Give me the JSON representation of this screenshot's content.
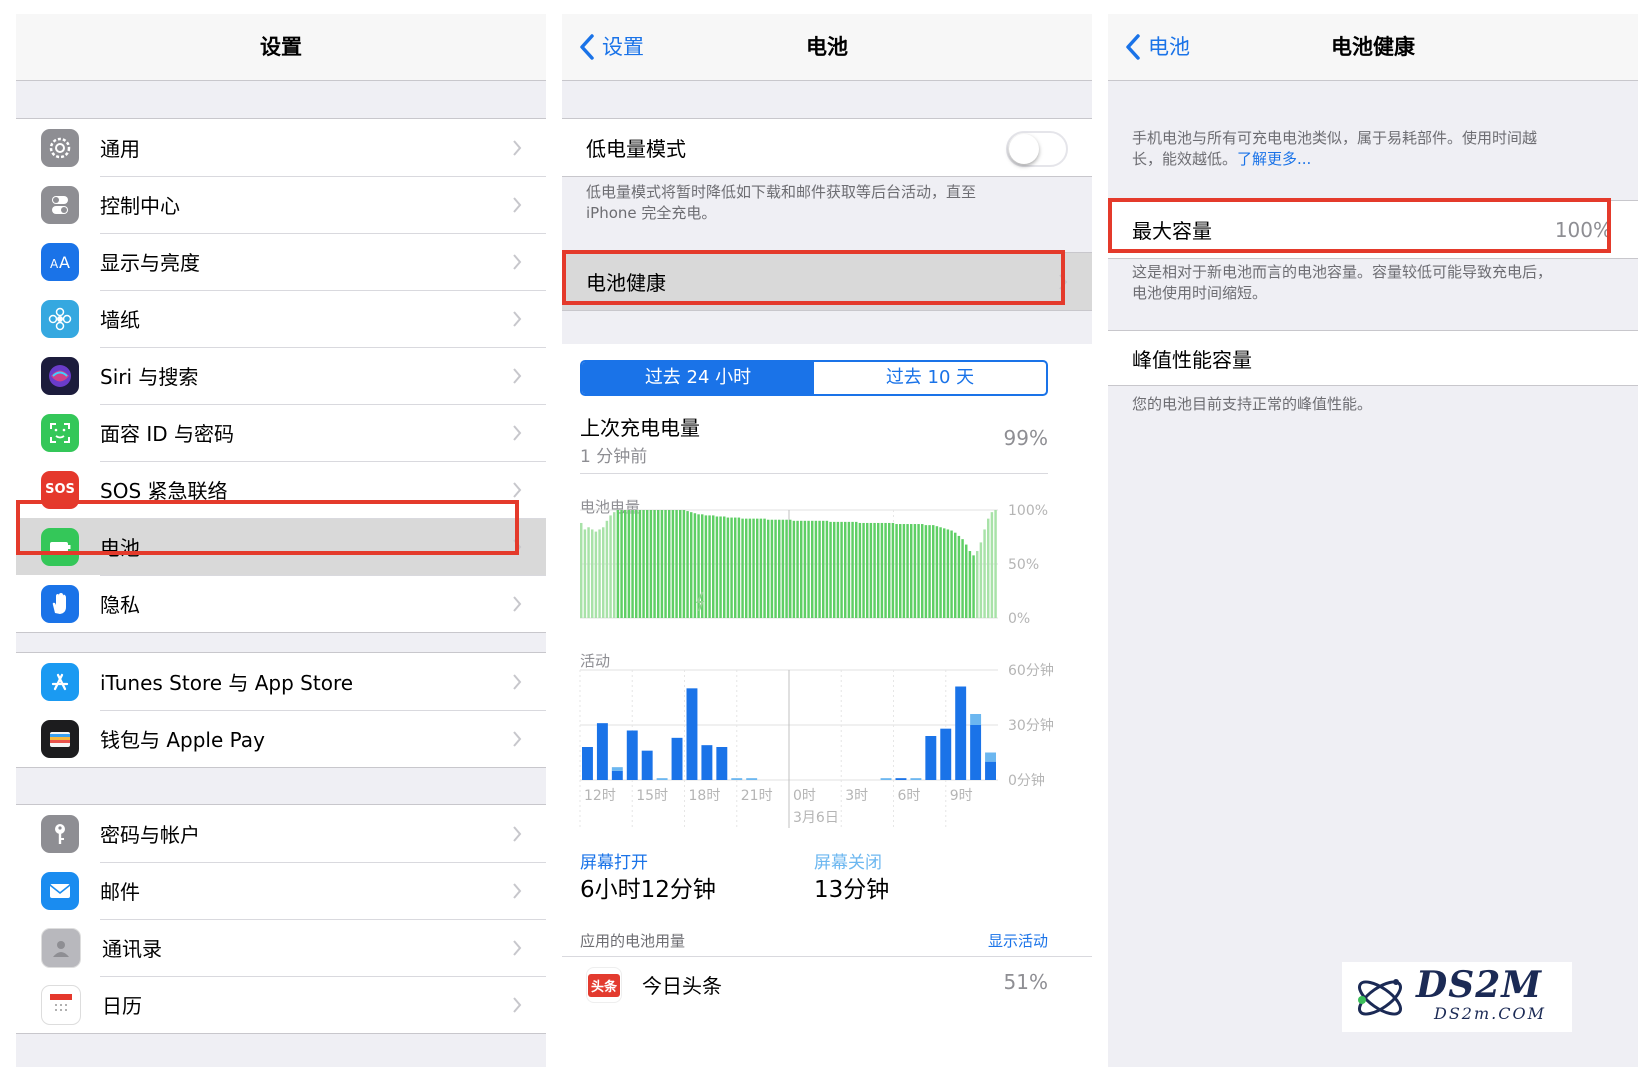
{
  "settings": {
    "title": "设置",
    "group1": [
      {
        "label": "通用",
        "icon": "gear-icon",
        "color": "#8e8e93"
      },
      {
        "label": "控制中心",
        "icon": "toggles-icon",
        "color": "#8e8e93"
      },
      {
        "label": "显示与亮度",
        "icon": "text-size-icon",
        "color": "#1a73e8"
      },
      {
        "label": "墙纸",
        "icon": "flower-icon",
        "color": "#35a8e0"
      },
      {
        "label": "Siri 与搜索",
        "icon": "siri-icon",
        "color": "#1c1c3c"
      },
      {
        "label": "面容 ID 与密码",
        "icon": "face-id-icon",
        "color": "#34c759"
      },
      {
        "label": "SOS 紧急联络",
        "icon": "sos-icon",
        "color": "#e5382c",
        "icon_text": "SOS"
      },
      {
        "label": "电池",
        "icon": "battery-icon",
        "color": "#34c759"
      },
      {
        "label": "隐私",
        "icon": "hand-icon",
        "color": "#1a73e8"
      }
    ],
    "group2": [
      {
        "label": "iTunes Store 与 App Store",
        "icon": "app-store-icon",
        "color": "#1a9af2"
      },
      {
        "label": "钱包与 Apple Pay",
        "icon": "wallet-icon",
        "color": "#1c1c1e"
      }
    ],
    "group3": [
      {
        "label": "密码与帐户",
        "icon": "key-icon",
        "color": "#8e8e93"
      },
      {
        "label": "邮件",
        "icon": "mail-icon",
        "color": "#1a8cf0"
      },
      {
        "label": "通讯录",
        "icon": "contacts-icon",
        "color": "#b8b8bd"
      },
      {
        "label": "日历",
        "icon": "calendar-icon",
        "color": "#ffffff"
      }
    ]
  },
  "battery": {
    "back": "设置",
    "title": "电池",
    "low_power_label": "低电量模式",
    "low_power_on": false,
    "low_power_desc_1": "低电量模式将暂时降低如下载和邮件获取等后台活动，直至",
    "low_power_desc_2": "iPhone 完全充电。",
    "health_label": "电池健康",
    "seg_24h": "过去 24 小时",
    "seg_10d": "过去 10 天",
    "last_charge_label": "上次充电电量",
    "last_charge_time": "1 分钟前",
    "last_charge_value": "99%",
    "level_chart_label": "电池电量",
    "activity_chart_label": "活动",
    "screen_on_label": "屏幕打开",
    "screen_on_value": "6小时12分钟",
    "screen_off_label": "屏幕关闭",
    "screen_off_value": "13分钟",
    "app_usage_label": "应用的电池用量",
    "show_activity": "显示活动",
    "app": {
      "name": "今日头条",
      "icon_text": "头条",
      "value": "51%"
    }
  },
  "health": {
    "back": "电池",
    "title": "电池健康",
    "intro_1": "手机电池与所有可充电电池类似，属于易耗部件。使用时间越",
    "intro_2": "长，能效越低。",
    "learn_more": "了解更多...",
    "max_capacity_label": "最大容量",
    "max_capacity_value": "100%",
    "capacity_desc_1": "这是相对于新电池而言的电池容量。容量较低可能导致充电后，",
    "capacity_desc_2": "电池使用时间缩短。",
    "peak_label": "峰值性能容量",
    "peak_desc": "您的电池目前支持正常的峰值性能。"
  },
  "chart_data": [
    {
      "type": "bar",
      "title": "电池电量",
      "yticks": [
        "100%",
        "50%",
        "0%"
      ],
      "ylim": [
        0,
        100
      ],
      "values": [
        88,
        82,
        84,
        82,
        80,
        82,
        84,
        90,
        95,
        98,
        100,
        100,
        100,
        100,
        100,
        100,
        100,
        100,
        100,
        100,
        100,
        100,
        100,
        100,
        100,
        100,
        100,
        100,
        100,
        99,
        98,
        97,
        96,
        96,
        95,
        95,
        95,
        94,
        94,
        94,
        93,
        93,
        93,
        93,
        92,
        92,
        92,
        92,
        92,
        92,
        92,
        91,
        91,
        91,
        91,
        91,
        91,
        91,
        90,
        90,
        90,
        90,
        90,
        90,
        90,
        90,
        90,
        90,
        89,
        89,
        89,
        89,
        89,
        89,
        89,
        89,
        88,
        88,
        88,
        88,
        88,
        88,
        88,
        88,
        88,
        88,
        87,
        87,
        87,
        87,
        87,
        87,
        87,
        87,
        86,
        86,
        86,
        85,
        84,
        83,
        82,
        81,
        79,
        76,
        73,
        68,
        62,
        58,
        62,
        70,
        82,
        92,
        98,
        100
      ],
      "charging": [
        1,
        1,
        1,
        1,
        1,
        1,
        1,
        1,
        1,
        1,
        0,
        0,
        0,
        0,
        0,
        0,
        0,
        0,
        0,
        0,
        0,
        0,
        0,
        0,
        0,
        0,
        0,
        0,
        0,
        0,
        0,
        0,
        0,
        0,
        0,
        0,
        0,
        0,
        0,
        0,
        0,
        0,
        0,
        0,
        0,
        0,
        0,
        0,
        0,
        0,
        0,
        0,
        0,
        0,
        0,
        0,
        0,
        0,
        0,
        0,
        0,
        0,
        0,
        0,
        0,
        0,
        0,
        0,
        0,
        0,
        0,
        0,
        0,
        0,
        0,
        0,
        0,
        0,
        0,
        0,
        0,
        0,
        0,
        0,
        0,
        0,
        0,
        0,
        0,
        0,
        0,
        0,
        0,
        0,
        0,
        0,
        0,
        0,
        0,
        0,
        0,
        0,
        0,
        0,
        0,
        0,
        0,
        0,
        1,
        1,
        1,
        1,
        1,
        1
      ]
    },
    {
      "type": "bar",
      "title": "活动",
      "yticks": [
        "60分钟",
        "30分钟",
        "0分钟"
      ],
      "ylim": [
        0,
        60
      ],
      "categories": [
        "12时",
        "15时",
        "18时",
        "21时",
        "0时",
        "3时",
        "6时",
        "9时"
      ],
      "date_label": "3月6日",
      "series": [
        {
          "name": "屏幕打开",
          "values": [
            18,
            31,
            5,
            27,
            16,
            0,
            23,
            50,
            19,
            18,
            0,
            0,
            0,
            0,
            0,
            0,
            0,
            0,
            0,
            0,
            0,
            1,
            0,
            24,
            28,
            51,
            30,
            10
          ]
        },
        {
          "name": "屏幕关闭",
          "values": [
            0,
            0,
            2,
            0,
            0,
            1,
            0,
            0,
            0,
            0,
            1,
            1,
            0,
            0,
            0,
            0,
            0,
            0,
            0,
            0,
            1,
            0,
            1,
            0,
            0,
            0,
            6,
            5
          ]
        }
      ]
    }
  ],
  "watermark": {
    "brand": "DS2M",
    "url": "DS2m.COM"
  }
}
